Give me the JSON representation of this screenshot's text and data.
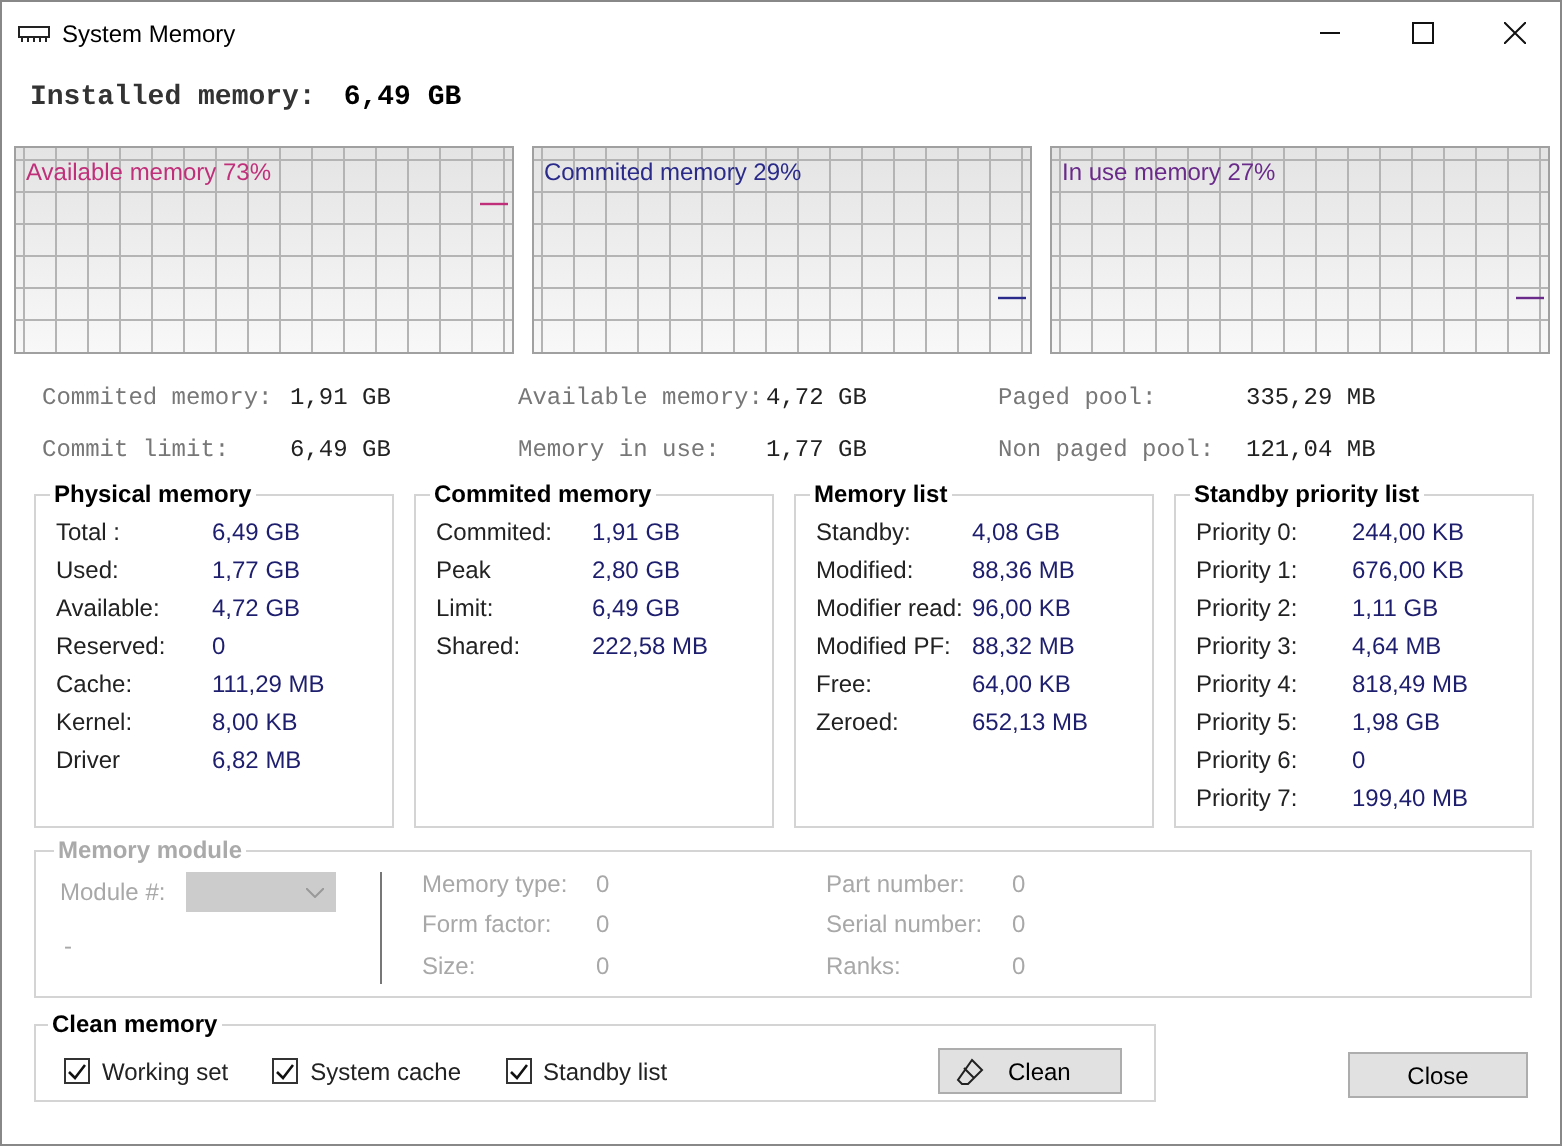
{
  "window": {
    "title": "System Memory"
  },
  "installed": {
    "label": "Installed memory:",
    "value": "6,49 GB"
  },
  "graphs": [
    {
      "label": "Available memory 73%",
      "color": "#c0307a"
    },
    {
      "label": "Commited memory 29%",
      "color": "#2a2a8a"
    },
    {
      "label": "In use memory 27%",
      "color": "#6a2a8a"
    }
  ],
  "stats": [
    {
      "label": "Commited memory:",
      "value": "1,91 GB"
    },
    {
      "label": "Available memory:",
      "value": "4,72 GB"
    },
    {
      "label": "Paged pool:",
      "value": "335,29 MB"
    },
    {
      "label": "Commit limit:",
      "value": "6,49 GB"
    },
    {
      "label": "Memory in use:",
      "value": "1,77 GB"
    },
    {
      "label": "Non paged pool:",
      "value": "121,04 MB"
    }
  ],
  "groups": [
    {
      "title": "Physical memory",
      "rows": [
        {
          "label": "Total :",
          "value": "6,49 GB"
        },
        {
          "label": "Used:",
          "value": "1,77 GB"
        },
        {
          "label": "Available:",
          "value": "4,72 GB"
        },
        {
          "label": "Reserved:",
          "value": "0"
        },
        {
          "label": "Cache:",
          "value": "111,29 MB"
        },
        {
          "label": "Kernel:",
          "value": "8,00 KB"
        },
        {
          "label": "Driver",
          "value": "6,82 MB"
        }
      ]
    },
    {
      "title": "Commited memory",
      "rows": [
        {
          "label": "Commited:",
          "value": "1,91 GB"
        },
        {
          "label": "Peak",
          "value": "2,80 GB"
        },
        {
          "label": "Limit:",
          "value": "6,49 GB"
        },
        {
          "label": "Shared:",
          "value": "222,58 MB"
        }
      ]
    },
    {
      "title": "Memory list",
      "rows": [
        {
          "label": "Standby:",
          "value": "4,08 GB"
        },
        {
          "label": "Modified:",
          "value": "88,36 MB"
        },
        {
          "label": "Modifier read:",
          "value": "96,00 KB"
        },
        {
          "label": "Modified PF:",
          "value": "88,32 MB"
        },
        {
          "label": "Free:",
          "value": "64,00 KB"
        },
        {
          "label": "Zeroed:",
          "value": "652,13 MB"
        }
      ]
    },
    {
      "title": "Standby priority list",
      "rows": [
        {
          "label": "Priority 0:",
          "value": "244,00 KB"
        },
        {
          "label": "Priority 1:",
          "value": "676,00 KB"
        },
        {
          "label": "Priority 2:",
          "value": "1,11 GB"
        },
        {
          "label": "Priority 3:",
          "value": "4,64 MB"
        },
        {
          "label": "Priority 4:",
          "value": "818,49 MB"
        },
        {
          "label": "Priority 5:",
          "value": "1,98 GB"
        },
        {
          "label": "Priority 6:",
          "value": "0"
        },
        {
          "label": "Priority 7:",
          "value": "199,40 MB"
        }
      ]
    }
  ],
  "memory_module": {
    "title": "Memory module",
    "disabled": true,
    "module_label": "Module #:",
    "note": "-",
    "fields": [
      {
        "label": "Memory type:",
        "value": "0"
      },
      {
        "label": "Form factor:",
        "value": "0"
      },
      {
        "label": "Size:",
        "value": "0"
      },
      {
        "label": "Part number:",
        "value": "0"
      },
      {
        "label": "Serial number:",
        "value": "0"
      },
      {
        "label": "Ranks:",
        "value": "0"
      }
    ]
  },
  "clean_memory": {
    "title": "Clean memory",
    "options": [
      {
        "label": "Working set",
        "checked": true
      },
      {
        "label": "System cache",
        "checked": true
      },
      {
        "label": "Standby list",
        "checked": true
      }
    ],
    "clean_button": "Clean"
  },
  "close_button": "Close"
}
